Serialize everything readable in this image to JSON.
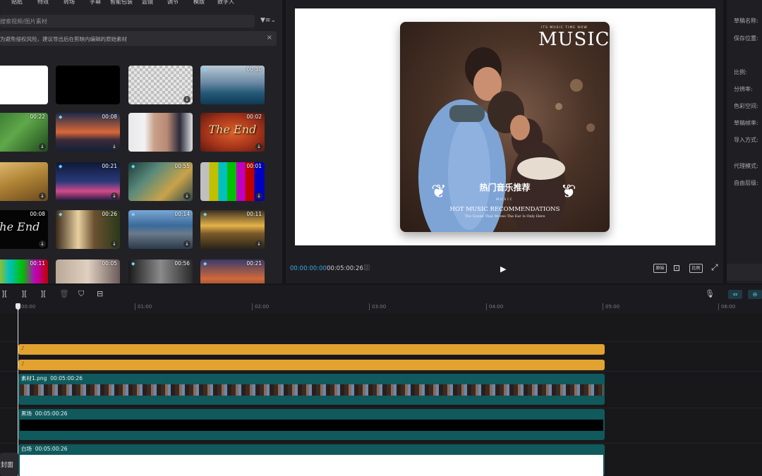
{
  "media_tabs": [
    "贴纸",
    "特效",
    "转场",
    "字幕",
    "智能包装",
    "滤镜",
    "调节",
    "模版",
    "数字人"
  ],
  "search": {
    "placeholder": "搜索视频/图片素材"
  },
  "notice": {
    "text": "为避免侵权风险，建议导出后在剪映内编辑的原始素材",
    "close": "×"
  },
  "media_grid": [
    [
      {
        "dur": ""
      },
      {
        "dur": ""
      },
      {
        "dur": ""
      },
      {
        "dur": "00:30"
      }
    ],
    [
      {
        "dur": "00:22"
      },
      {
        "dur": "00:08"
      },
      {
        "dur": ""
      },
      {
        "dur": "00:02"
      }
    ],
    [
      {
        "dur": ""
      },
      {
        "dur": "00:21"
      },
      {
        "dur": "00:55"
      },
      {
        "dur": "00:01"
      }
    ],
    [
      {
        "dur": "00:08"
      },
      {
        "dur": "00:26"
      },
      {
        "dur": "00:14"
      },
      {
        "dur": "00:11"
      }
    ],
    [
      {
        "dur": "00:11"
      },
      {
        "dur": "00:05"
      },
      {
        "dur": "00:56"
      },
      {
        "dur": "00:21"
      }
    ]
  ],
  "thumb_titles": {
    "the_end_1": "The End",
    "the_end_2": "The End"
  },
  "poster": {
    "music_small": "ITS MUSIC TIME NOW",
    "music": "MUSIC",
    "title_cn": "热门音乐推荐",
    "music_small_2": "MUSIC",
    "title_en": "HOT MUSIC RECOMMENDATIONS",
    "subtitle": "The Sound That Moves The Ear Is Only Here"
  },
  "player": {
    "current_time": "00:00:00:00",
    "total_time": "00:05:00:26",
    "btn_original": "原始",
    "btn_ratio": "比例"
  },
  "props": {
    "labels": [
      "草稿名称:",
      "保存位置:",
      "比例:",
      "分辨率:",
      "色彩空间:",
      "草稿帧率:",
      "导入方式:",
      "代理模式:",
      "自由层级:"
    ]
  },
  "ruler": {
    "ticks": [
      "00:00",
      "01:00",
      "02:00",
      "03:00",
      "04:00",
      "05:00",
      "06:00"
    ]
  },
  "tracks": {
    "clip_image": {
      "name": "素材1.png",
      "duration": "00:05:00:26"
    },
    "clip_black": {
      "name": "黑场",
      "duration": "00:05:00:26"
    },
    "clip_white": {
      "name": "白场",
      "duration": "00:05:00:26"
    }
  },
  "cover_label": "封面",
  "colors": {
    "accent": "#3aa8e6",
    "audio_clip": "#e1a230",
    "video_clip": "#10595c",
    "bg": "#151518"
  }
}
